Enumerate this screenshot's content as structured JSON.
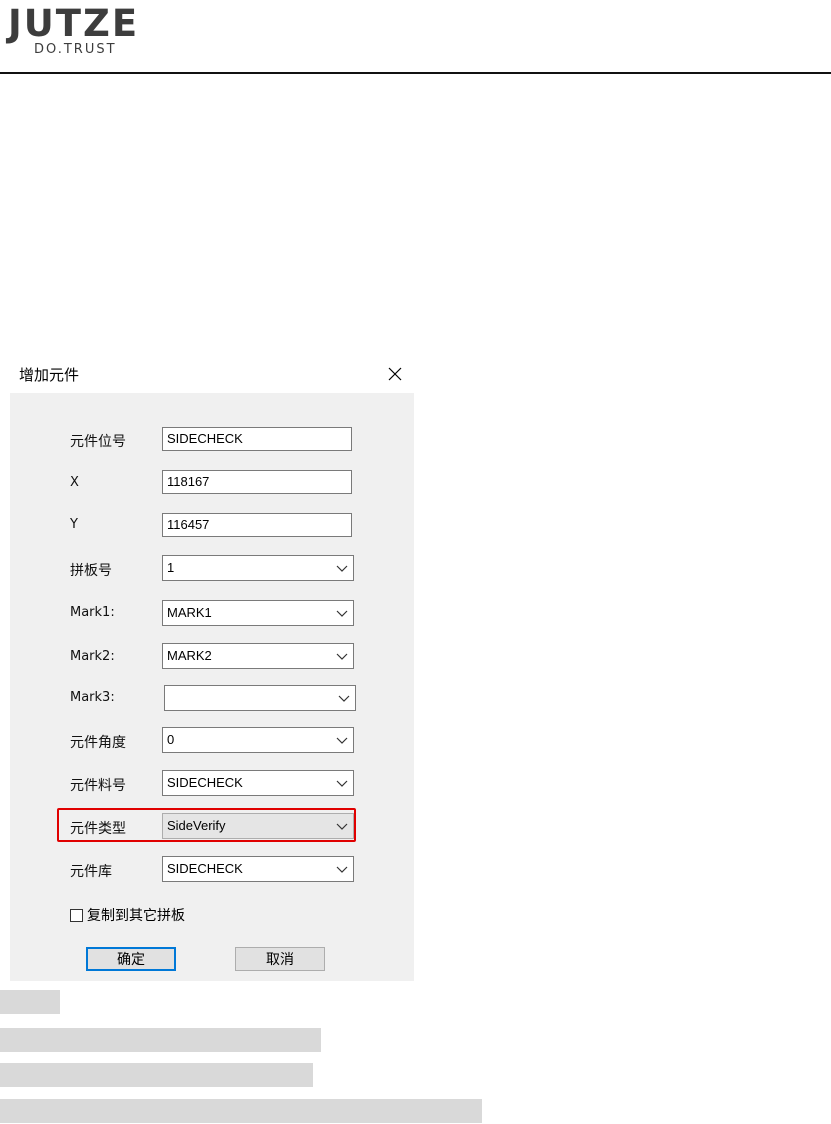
{
  "header": {
    "logo_text": "JUTZE",
    "logo_tagline": "DO.TRUST"
  },
  "dialog": {
    "title": "增加元件",
    "close_icon": "close-icon",
    "fields": {
      "ref_label": "元件位号",
      "ref_value": "SIDECHECK",
      "x_label": "X",
      "x_value": "118167",
      "y_label": "Y",
      "y_value": "116457",
      "panel_label": "拼板号",
      "panel_value": "1",
      "mark1_label": "Mark1:",
      "mark1_value": "MARK1",
      "mark2_label": "Mark2:",
      "mark2_value": "MARK2",
      "mark3_label": "Mark3:",
      "mark3_value": "",
      "angle_label": "元件角度",
      "angle_value": "0",
      "partno_label": "元件料号",
      "partno_value": "SIDECHECK",
      "type_label": "元件类型",
      "type_value": "SideVerify",
      "library_label": "元件库",
      "library_value": "SIDECHECK"
    },
    "copy_checkbox": {
      "label": "复制到其它拼板",
      "checked": false
    },
    "ok_button": "确定",
    "cancel_button": "取消"
  },
  "colors": {
    "highlight_border": "#e00000",
    "primary_button_border": "#0078d7",
    "dialog_background": "#f0f0f0"
  }
}
